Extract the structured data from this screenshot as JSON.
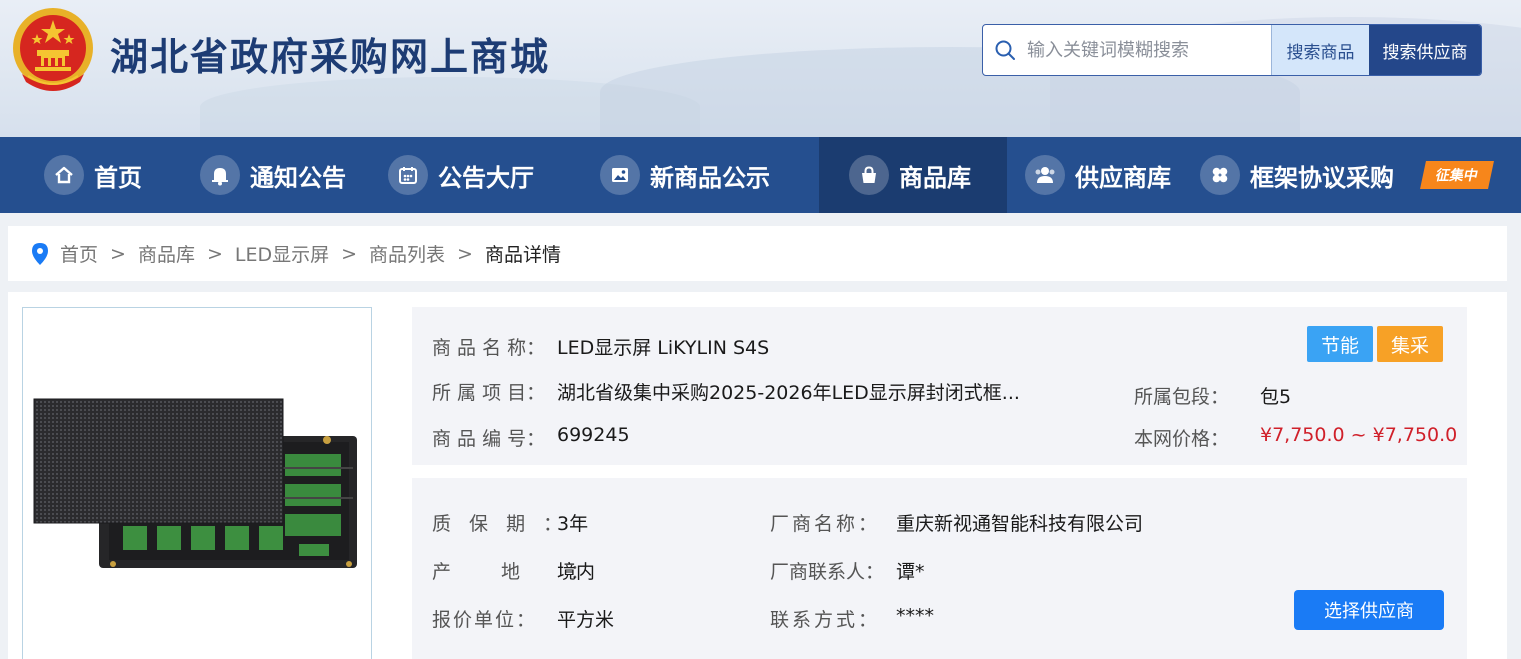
{
  "site": {
    "title": "湖北省政府采购网上商城"
  },
  "search": {
    "placeholder": "输入关键词模糊搜索",
    "btn_goods": "搜索商品",
    "btn_supplier": "搜索供应商"
  },
  "nav": {
    "items": [
      {
        "label": "首页",
        "icon": "home-icon"
      },
      {
        "label": "通知公告",
        "icon": "bell-icon"
      },
      {
        "label": "公告大厅",
        "icon": "calendar-icon"
      },
      {
        "label": "新商品公示",
        "icon": "image-icon"
      },
      {
        "label": "商品库",
        "icon": "shopping-bag-icon",
        "active": true
      },
      {
        "label": "供应商库",
        "icon": "users-icon"
      },
      {
        "label": "框架协议采购",
        "icon": "four-leaf-icon",
        "badge": "征集中"
      }
    ]
  },
  "breadcrumb": {
    "items": [
      "首页",
      "商品库",
      "LED显示屏",
      "商品列表"
    ],
    "current": "商品详情",
    "sep": ">"
  },
  "product": {
    "name_label": "商 品 名 称：",
    "name": "LED显示屏 LiKYLIN S4S",
    "project_label": "所 属 项 目：",
    "project": "湖北省级集中采购2025-2026年LED显示屏封闭式框...",
    "code_label": "商 品 编 号：",
    "code": "699245",
    "package_label": "所属包段：",
    "package": "包5",
    "price_label": "本网价格：",
    "price": "¥7,750.0 ~ ¥7,750.0",
    "tags": [
      "节能",
      "集采"
    ]
  },
  "details": {
    "warranty_label": "质 保 期 ：",
    "warranty": "3年",
    "origin_label": "产 地 ：",
    "origin": "境内",
    "unit_label": "报价单位：",
    "unit": "平方米",
    "maker_label": "厂商名称：",
    "maker": "重庆新视通智能科技有限公司",
    "contact_label": "厂商联系人：",
    "contact": "谭*",
    "phone_label": "联系方式：",
    "phone": "****",
    "select_button": "选择供应商"
  },
  "colors": {
    "nav_bg": "#254f8f",
    "nav_active": "#1b3c70",
    "price": "#d0202a",
    "tag_energy": "#3aa3f4",
    "tag_collect": "#f7a126",
    "primary": "#1a7bf5"
  }
}
